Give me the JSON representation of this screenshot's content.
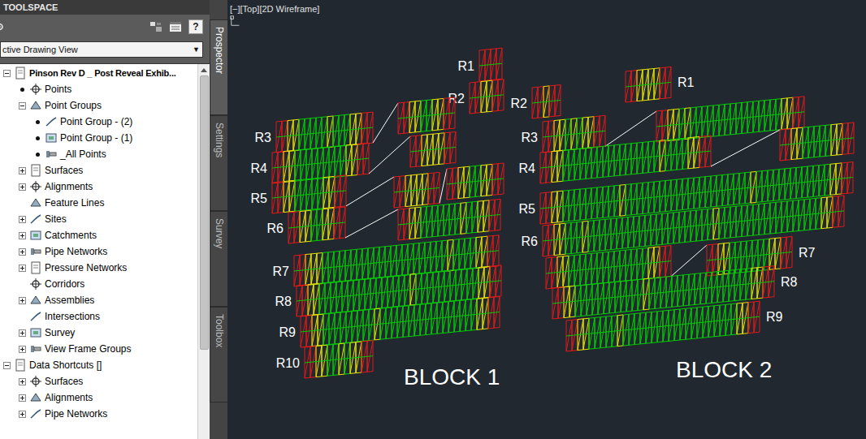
{
  "toolspace": {
    "title": "TOOLSPACE",
    "help": "?",
    "view_select": {
      "value": "ctive Drawing View",
      "arrow": "▼"
    },
    "scroll": {
      "level": 0.8
    },
    "tree": [
      {
        "label": "Pinson Rev D _ Post Reveal Exhib...",
        "kind": "branch",
        "expanded": true,
        "marked": false,
        "children": [
          {
            "label": "Points",
            "kind": "leaf",
            "marked": true,
            "children": []
          },
          {
            "label": "Point Groups",
            "kind": "branch",
            "expanded": true,
            "marked": false,
            "children": [
              {
                "label": "Point Group - (2)",
                "kind": "leaf",
                "marked": true,
                "children": []
              },
              {
                "label": "Point Group - (1)",
                "kind": "leaf",
                "marked": true,
                "children": []
              },
              {
                "label": "_All Points",
                "kind": "leaf",
                "marked": true,
                "children": []
              }
            ]
          },
          {
            "label": "Surfaces",
            "kind": "branch",
            "expanded": false,
            "marked": false,
            "children": []
          },
          {
            "label": "Alignments",
            "kind": "branch",
            "expanded": false,
            "marked": false,
            "children": []
          },
          {
            "label": "Feature Lines",
            "kind": "leaf",
            "marked": false,
            "children": []
          },
          {
            "label": "Sites",
            "kind": "branch",
            "expanded": false,
            "marked": false,
            "children": []
          },
          {
            "label": "Catchments",
            "kind": "branch",
            "expanded": false,
            "marked": false,
            "children": []
          },
          {
            "label": "Pipe Networks",
            "kind": "branch",
            "expanded": false,
            "marked": false,
            "children": []
          },
          {
            "label": "Pressure Networks",
            "kind": "branch",
            "expanded": false,
            "marked": false,
            "children": []
          },
          {
            "label": "Corridors",
            "kind": "leaf",
            "marked": false,
            "children": []
          },
          {
            "label": "Assemblies",
            "kind": "branch",
            "expanded": false,
            "marked": false,
            "children": []
          },
          {
            "label": "Intersections",
            "kind": "leaf",
            "marked": false,
            "children": []
          },
          {
            "label": "Survey",
            "kind": "branch",
            "expanded": false,
            "marked": false,
            "children": []
          },
          {
            "label": "View Frame Groups",
            "kind": "branch",
            "expanded": false,
            "marked": false,
            "children": []
          }
        ]
      },
      {
        "label": "Data Shortcuts []",
        "kind": "branch",
        "expanded": true,
        "marked": false,
        "children": [
          {
            "label": "Surfaces",
            "kind": "branch",
            "expanded": false,
            "marked": false,
            "children": []
          },
          {
            "label": "Alignments",
            "kind": "branch",
            "expanded": false,
            "marked": false,
            "children": []
          },
          {
            "label": "Pipe Networks",
            "kind": "branch",
            "expanded": false,
            "marked": false,
            "children": []
          }
        ]
      }
    ]
  },
  "side_tabs": [
    {
      "label": "Prospector",
      "selected": true
    },
    {
      "label": "Settings",
      "selected": false
    },
    {
      "label": "Survey",
      "selected": false
    },
    {
      "label": "Toolbox",
      "selected": false
    }
  ],
  "viewport": {
    "label": "[−][Top][2D Wireframe]",
    "blocks": [
      {
        "title": "BLOCK 1",
        "rows": [
          {
            "label": "R1"
          },
          {
            "label": "R2"
          },
          {
            "label": "R3"
          },
          {
            "label": "R4"
          },
          {
            "label": "R5"
          },
          {
            "label": "R6"
          },
          {
            "label": "R7"
          },
          {
            "label": "R8"
          },
          {
            "label": "R9"
          },
          {
            "label": "R10"
          }
        ]
      },
      {
        "title": "BLOCK 2",
        "rows": [
          {
            "label": "R1"
          },
          {
            "label": "R2"
          },
          {
            "label": "R3"
          },
          {
            "label": "R4"
          },
          {
            "label": "R5"
          },
          {
            "label": "R6"
          },
          {
            "label": "R7"
          },
          {
            "label": "R8"
          },
          {
            "label": "R9"
          }
        ]
      }
    ]
  }
}
